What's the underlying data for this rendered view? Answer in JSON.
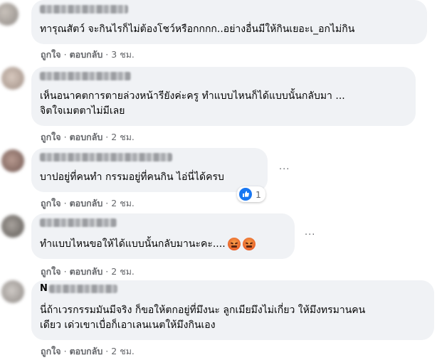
{
  "comments": [
    {
      "name": "",
      "lines": [
        "ทารุณสัตว์ จะกินไรก็ไม่ต้องโชว์หรือกกกก..อย่างอื่นมีให้กินเยอะเ_อกไม่กิน"
      ],
      "like": "ถูกใจ",
      "reply": "ตอบกลับ",
      "time": "3 ชม."
    },
    {
      "name": "",
      "lines": [
        "เห็นอนาคตการตายล่วงหน้ารียังค่ะครู ทำแบบไหนก็ได้แบบนั้นกลับมา ...",
        "จิตใจเมตตาไม่มีเลย"
      ],
      "like": "ถูกใจ",
      "reply": "ตอบกลับ",
      "time": "2 ชม."
    },
    {
      "name": "",
      "lines": [
        "บาปอยู่ที่คนทำ กรรมอยู่ที่คนกิน ไอ่นี่ได้ครบ"
      ],
      "like": "ถูกใจ",
      "reply": "ตอบกลับ",
      "time": "2 ชม.",
      "reaction_count": "1",
      "more": "···"
    },
    {
      "name": "",
      "lines": [
        "ทำแบบไหนขอให้ได้แบบนั้นกลับมานะคะ...."
      ],
      "like": "ถูกใจ",
      "reply": "ตอบกลับ",
      "time": "2 ชม.",
      "more": "···"
    },
    {
      "name": "N",
      "lines": [
        "นี่ถ้าเวรกรรมมันมีจริง ก็ขอให้ตกอยู่ที่มึงนะ ลูกเมียมึงไม่เกี่ยว ให้มึงทรมานคน",
        "เดียว เด่วเขาเบื่อก็เอาเลนเนตให้มึงกินเอง"
      ],
      "like": "ถูกใจ",
      "reply": "ตอบกลับ",
      "time": "2 ชม."
    }
  ],
  "separator": "·",
  "colors": {
    "bubble": "#f0f2f5",
    "meta": "#65676b",
    "text": "#050505",
    "like_blue": "#1877f2"
  }
}
